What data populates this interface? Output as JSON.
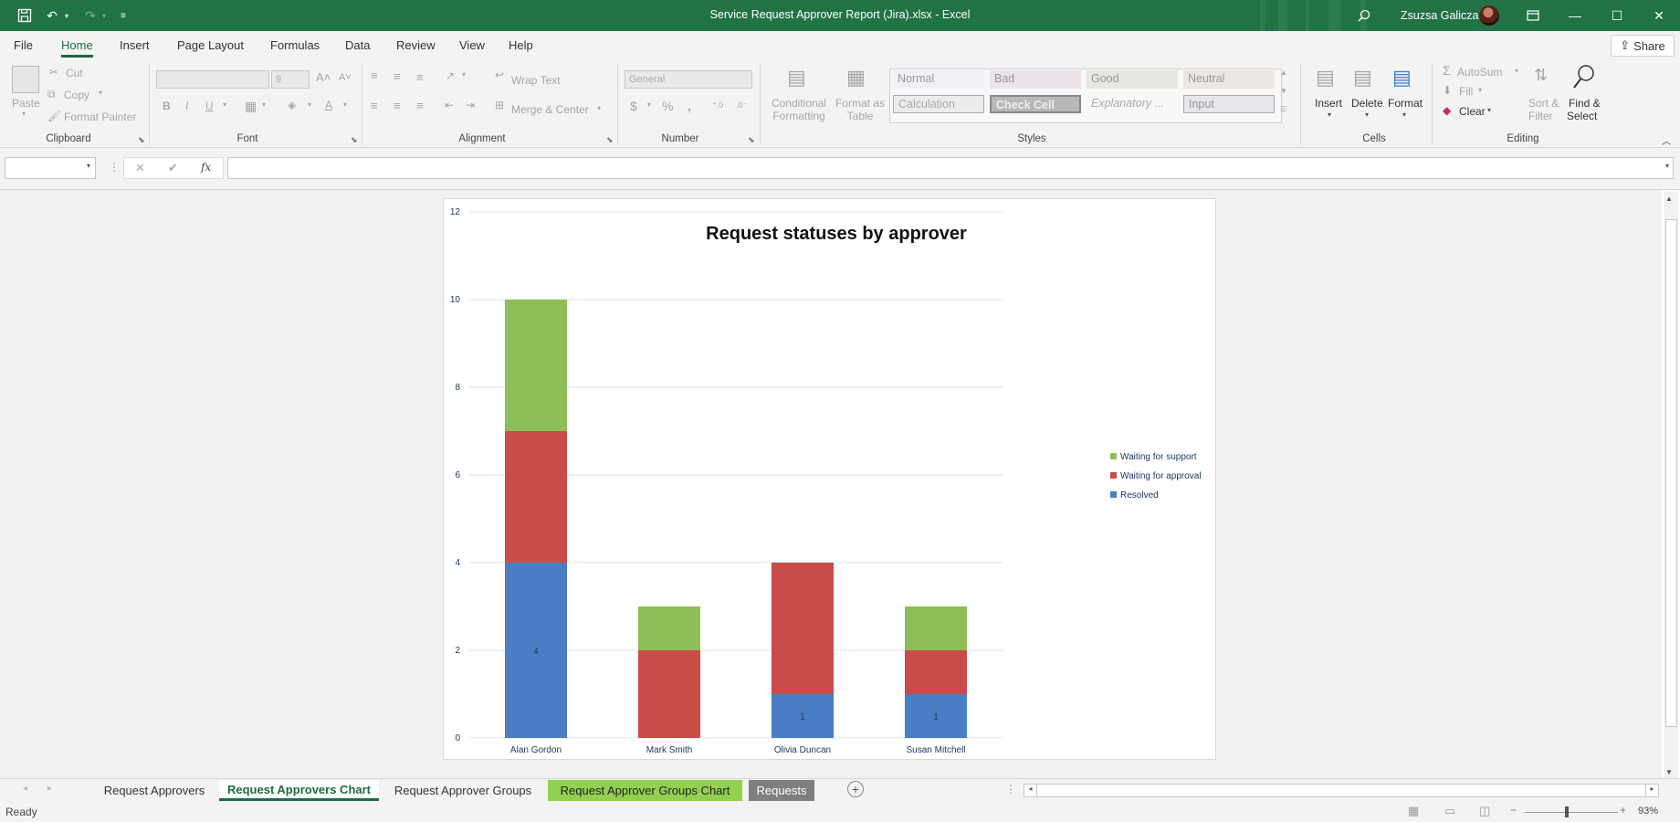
{
  "window": {
    "title": "Service Request Approver Report (Jira).xlsx  -  Excel",
    "user": "Zsuzsa Galicza",
    "app_color": "#217346"
  },
  "menu": {
    "tabs": [
      "File",
      "Home",
      "Insert",
      "Page Layout",
      "Formulas",
      "Data",
      "Review",
      "View",
      "Help"
    ],
    "active": "Home",
    "share": "Share"
  },
  "ribbon": {
    "clipboard": {
      "paste": "Paste",
      "cut": "Cut",
      "copy": "Copy",
      "format_painter": "Format Painter",
      "label": "Clipboard"
    },
    "font": {
      "size": "9",
      "label": "Font"
    },
    "alignment": {
      "wrap_text": "Wrap Text",
      "merge_center": "Merge & Center",
      "label": "Alignment"
    },
    "number": {
      "format": "General",
      "label": "Number"
    },
    "styles": {
      "conditional": [
        "Conditional",
        "Formatting"
      ],
      "format_table": [
        "Format as",
        "Table"
      ],
      "cells": [
        "Normal",
        "Bad",
        "Good",
        "Neutral",
        "Calculation",
        "Check Cell",
        "Explanatory ...",
        "Input"
      ],
      "label": "Styles"
    },
    "cells": {
      "insert": "Insert",
      "delete": "Delete",
      "format": "Format",
      "label": "Cells"
    },
    "editing": {
      "autosum": "AutoSum",
      "fill": "Fill",
      "clear": "Clear",
      "sort": [
        "Sort &",
        "Filter"
      ],
      "find": [
        "Find &",
        "Select"
      ],
      "label": "Editing"
    }
  },
  "formula_bar": {
    "name_box": "",
    "fx": "fx",
    "content": ""
  },
  "chart_data": {
    "type": "bar",
    "stacked": true,
    "title": "Request statuses by approver",
    "categories": [
      "Alan Gordon",
      "Mark Smith",
      "Olivia Duncan",
      "Susan Mitchell"
    ],
    "series": [
      {
        "name": "Resolved",
        "values": [
          4,
          0,
          1,
          1
        ],
        "color": "#4a7ec4",
        "labels": [
          "4",
          "",
          "1",
          "1"
        ]
      },
      {
        "name": "Waiting for approval",
        "values": [
          3,
          2,
          3,
          1
        ],
        "color": "#c84c4a"
      },
      {
        "name": "Waiting for support",
        "values": [
          3,
          1,
          0,
          1
        ],
        "color": "#8fbe58"
      }
    ],
    "ylim": [
      0,
      12
    ],
    "yticks": [
      "0",
      "2",
      "4",
      "6",
      "8",
      "10",
      "12"
    ],
    "grid": true,
    "legend_position": "right"
  },
  "sheet_tabs": [
    {
      "label": "Request Approvers",
      "style": "normal"
    },
    {
      "label": "Request Approvers Chart",
      "style": "active"
    },
    {
      "label": "Request Approver Groups",
      "style": "normal"
    },
    {
      "label": "Request Approver Groups Chart",
      "style": "green"
    },
    {
      "label": "Requests",
      "style": "gray"
    }
  ],
  "status": {
    "ready": "Ready",
    "zoom": "93%"
  }
}
